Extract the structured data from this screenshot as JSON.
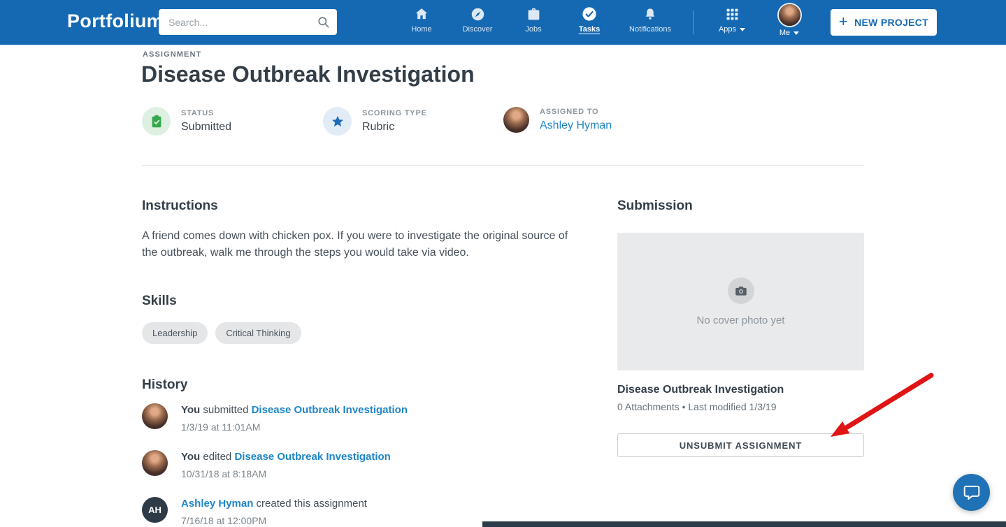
{
  "header": {
    "logo": "Portfolium",
    "search": {
      "placeholder": "Search..."
    },
    "nav": {
      "home": "Home",
      "discover": "Discover",
      "jobs": "Jobs",
      "tasks": "Tasks",
      "notifications": "Notifications"
    },
    "apps": "Apps",
    "me": "Me",
    "new_project": "NEW PROJECT"
  },
  "icons": {
    "plus": "+"
  },
  "assignment": {
    "eyebrow": "ASSIGNMENT",
    "title": "Disease Outbreak Investigation",
    "status_label": "STATUS",
    "status_value": "Submitted",
    "scoring_label": "SCORING TYPE",
    "scoring_value": "Rubric",
    "assigned_label": "ASSIGNED TO",
    "assigned_value": "Ashley Hyman"
  },
  "instructions": {
    "heading": "Instructions",
    "body": "A friend comes down with chicken pox. If you were to investigate the original source of the outbreak, walk me through the steps you would take via video."
  },
  "skills": {
    "heading": "Skills",
    "items": [
      "Leadership",
      "Critical Thinking"
    ]
  },
  "history": {
    "heading": "History",
    "items": [
      {
        "actor": "You",
        "action": " submitted ",
        "object": "Disease Outbreak Investigation",
        "timestamp": "1/3/19 at 11:01AM"
      },
      {
        "actor": "You",
        "action": " edited ",
        "object": "Disease Outbreak Investigation",
        "timestamp": "10/31/18 at 8:18AM"
      },
      {
        "actor": "Ashley Hyman",
        "action": " created this assignment",
        "object": "",
        "timestamp": "7/16/18 at 12:00PM",
        "initials": "AH"
      }
    ]
  },
  "submission": {
    "heading": "Submission",
    "cover_placeholder": "No cover photo yet",
    "title": "Disease Outbreak Investigation",
    "meta": "0 Attachments • Last modified 1/3/19",
    "unsubmit": "UNSUBMIT ASSIGNMENT"
  },
  "colors": {
    "header_blue": "#1569b3",
    "link_blue": "#1e86c7",
    "status_green": "#35a84c",
    "scoring_star_blue": "#1b6bb8",
    "annotation_red": "#e01414"
  }
}
